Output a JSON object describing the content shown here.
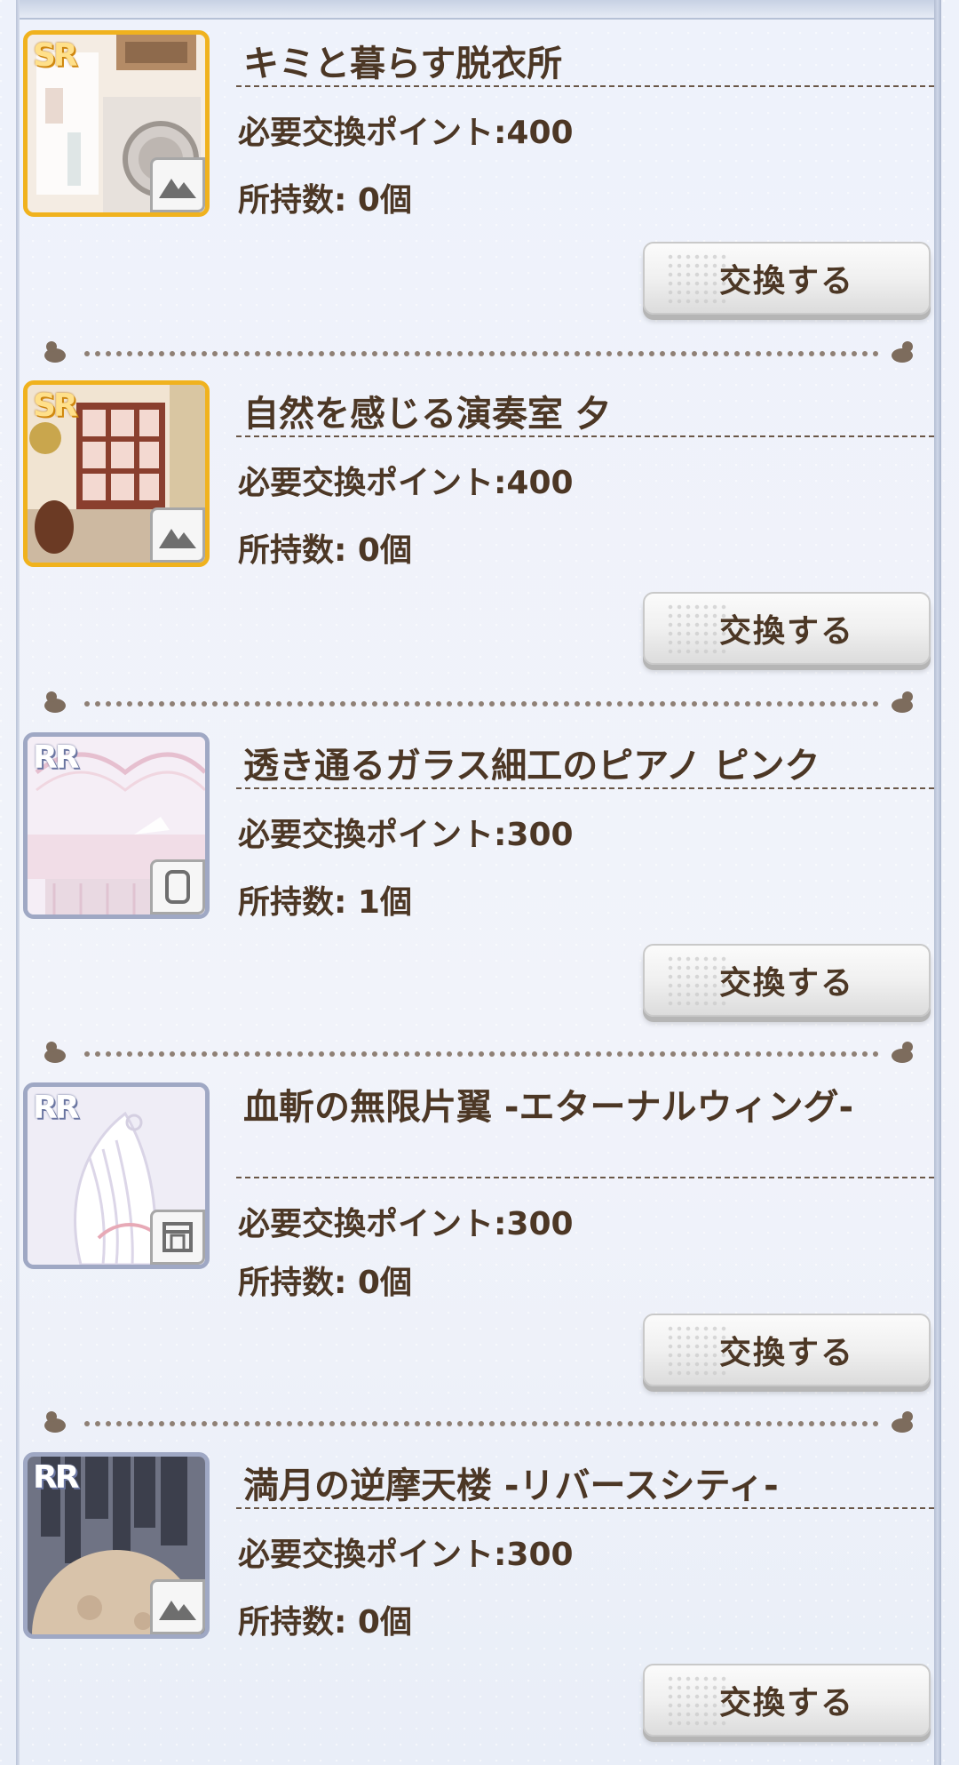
{
  "items": [
    {
      "name": "キミと暮らす脱衣所",
      "rarity": "SR",
      "type_icon": "mountain-picture-icon",
      "required": "必要交換ポイント:400",
      "owned": "所持数: 0個",
      "button": "交換する"
    },
    {
      "name": "自然を感じる演奏室 夕",
      "rarity": "SR",
      "type_icon": "mountain-picture-icon",
      "required": "必要交換ポイント:400",
      "owned": "所持数: 0個",
      "button": "交換する"
    },
    {
      "name": "透き通るガラス細工のピアノ ピンク",
      "rarity": "RR",
      "type_icon": "card-frame-icon",
      "required": "必要交換ポイント:300",
      "owned": "所持数: 1個",
      "button": "交換する"
    },
    {
      "name": "血斬の無限片翼 -エターナルウィング-",
      "rarity": "RR",
      "type_icon": "window-frame-icon",
      "required": "必要交換ポイント:300",
      "owned": "所持数: 0個",
      "button": "交換する"
    },
    {
      "name": "満月の逆摩天楼 -リバースシティ-",
      "rarity": "RR",
      "type_icon": "mountain-picture-icon",
      "required": "必要交換ポイント:300",
      "owned": "所持数: 0個",
      "button": "交換する"
    }
  ],
  "colors": {
    "text": "#4c3725",
    "sr_border": "#f0b21e",
    "rr_border": "#9fa8c4",
    "background": "#eef1f8"
  }
}
